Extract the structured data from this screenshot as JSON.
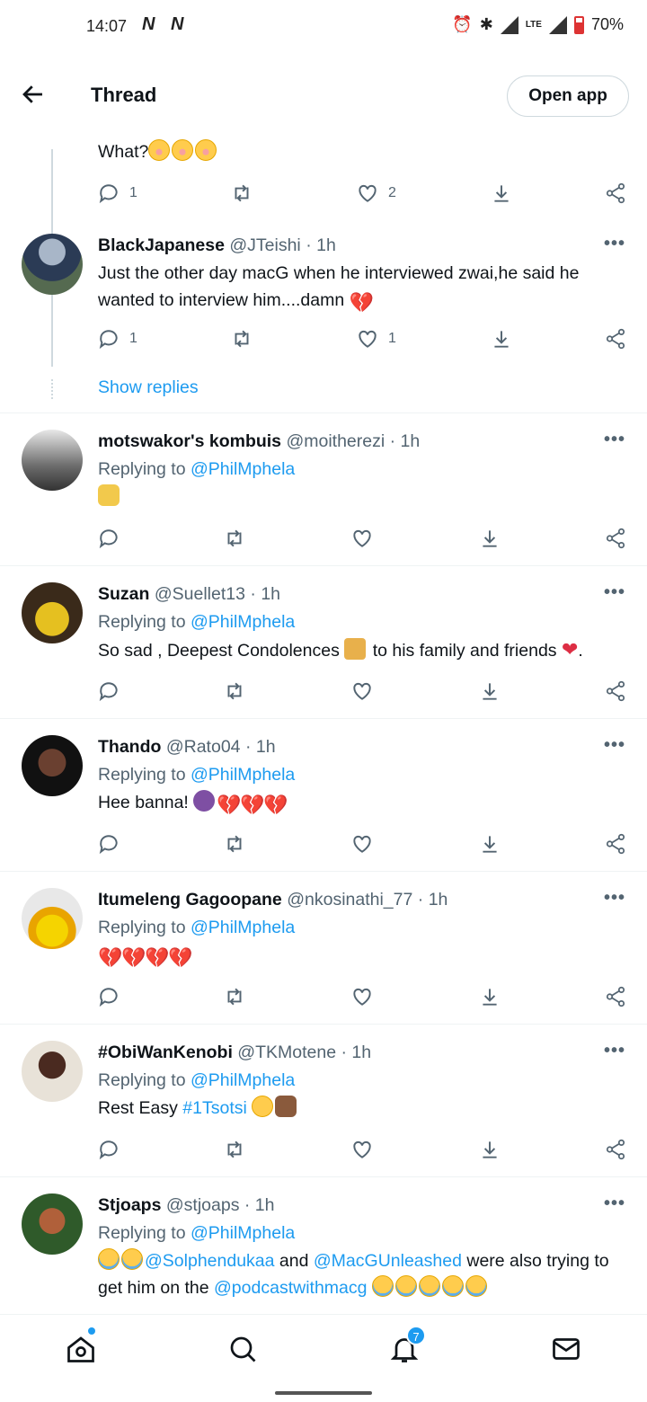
{
  "status_bar": {
    "time": "14:07",
    "notifications": "N N",
    "lte": "LTE",
    "battery": "70%"
  },
  "header": {
    "title": "Thread",
    "open_app_label": "Open app"
  },
  "colors": {
    "link": "#1d9bf0",
    "muted": "#536471",
    "text": "#0f1419",
    "divider": "#eff3f4"
  },
  "tweets": [
    {
      "partial_text": "What?",
      "reply_count": "1",
      "retweet_count": "",
      "like_count": "2"
    },
    {
      "name": "BlackJapanese",
      "handle": "@JTeishi",
      "sep": "·",
      "time": "1h",
      "text": "Just the other day macG when he interviewed zwai,he said he wanted to interview him....damn",
      "reply_count": "1",
      "retweet_count": "",
      "like_count": "1"
    },
    {
      "name": "motswakor's kombuis",
      "handle": "@moitherezi",
      "sep": "·",
      "time": "1h",
      "replying_prefix": "Replying to",
      "replying_to": "@PhilMphela"
    },
    {
      "name": "Suzan",
      "handle": "@Suellet13",
      "sep": "·",
      "time": "1h",
      "replying_prefix": "Replying to",
      "replying_to": "@PhilMphela",
      "text_a": "So sad , Deepest Condolences",
      "text_b": "to his family and friends",
      "text_c": "."
    },
    {
      "name": "Thando",
      "handle": "@Rato04",
      "sep": "·",
      "time": "1h",
      "replying_prefix": "Replying to",
      "replying_to": "@PhilMphela",
      "text": "Hee banna!"
    },
    {
      "name": "Itumeleng Gagoopane",
      "handle": "@nkosinathi_77",
      "sep": "·",
      "time": "1h",
      "replying_prefix": "Replying to",
      "replying_to": "@PhilMphela"
    },
    {
      "name": "#ObiWanKenobi",
      "handle": "@TKMotene",
      "sep": "·",
      "time": "1h",
      "replying_prefix": "Replying to",
      "replying_to": "@PhilMphela",
      "text": "Rest Easy",
      "hashtag": "#1Tsotsi"
    },
    {
      "name": "Stjoaps",
      "handle": "@stjoaps",
      "sep": "·",
      "time": "1h",
      "replying_prefix": "Replying to",
      "replying_to": "@PhilMphela",
      "mention1": "@Solphendukaa",
      "and": "and",
      "mention2": "@MacGUnleashed",
      "text_a": "were also trying",
      "text_b": "to get him on the",
      "mention3": "@podcastwithmacg"
    }
  ],
  "show_replies_label": "Show replies",
  "bottom_nav": {
    "notification_badge": "7"
  }
}
